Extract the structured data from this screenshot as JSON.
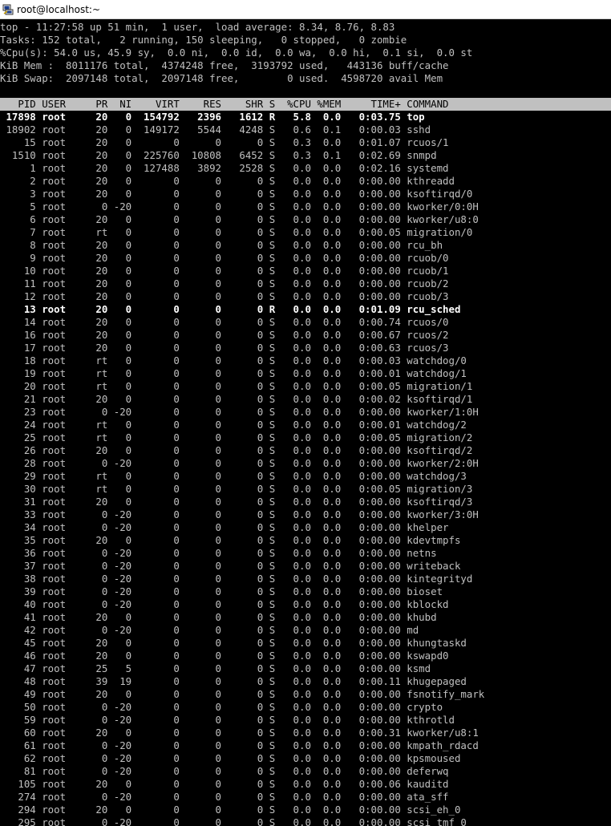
{
  "window": {
    "title": "root@localhost:~",
    "icon": "putty-icon"
  },
  "summary": [
    "top - 11:27:58 up 51 min,  1 user,  load average: 8.34, 8.76, 8.83",
    "Tasks: 152 total,   2 running, 150 sleeping,   0 stopped,   0 zombie",
    "%Cpu(s): 54.0 us, 45.9 sy,  0.0 ni,  0.0 id,  0.0 wa,  0.0 hi,  0.1 si,  0.0 st",
    "KiB Mem :  8011176 total,  4374248 free,  3193792 used,   443136 buff/cache",
    "KiB Swap:  2097148 total,  2097148 free,        0 used.  4598720 avail Mem"
  ],
  "columns": [
    "PID",
    "USER",
    "PR",
    "NI",
    "VIRT",
    "RES",
    "SHR",
    "S",
    "%CPU",
    "%MEM",
    "TIME+",
    "COMMAND"
  ],
  "processes": [
    [
      "17898",
      "root",
      "20",
      "0",
      "154792",
      "2396",
      "1612",
      "R",
      "5.8",
      "0.0",
      "0:03.75",
      "top"
    ],
    [
      "18902",
      "root",
      "20",
      "0",
      "149172",
      "5544",
      "4248",
      "S",
      "0.6",
      "0.1",
      "0:00.03",
      "sshd"
    ],
    [
      "15",
      "root",
      "20",
      "0",
      "0",
      "0",
      "0",
      "S",
      "0.3",
      "0.0",
      "0:01.07",
      "rcuos/1"
    ],
    [
      "1510",
      "root",
      "20",
      "0",
      "225760",
      "10808",
      "6452",
      "S",
      "0.3",
      "0.1",
      "0:02.69",
      "snmpd"
    ],
    [
      "1",
      "root",
      "20",
      "0",
      "127488",
      "3892",
      "2528",
      "S",
      "0.0",
      "0.0",
      "0:02.16",
      "systemd"
    ],
    [
      "2",
      "root",
      "20",
      "0",
      "0",
      "0",
      "0",
      "S",
      "0.0",
      "0.0",
      "0:00.00",
      "kthreadd"
    ],
    [
      "3",
      "root",
      "20",
      "0",
      "0",
      "0",
      "0",
      "S",
      "0.0",
      "0.0",
      "0:00.00",
      "ksoftirqd/0"
    ],
    [
      "5",
      "root",
      "0",
      "-20",
      "0",
      "0",
      "0",
      "S",
      "0.0",
      "0.0",
      "0:00.00",
      "kworker/0:0H"
    ],
    [
      "6",
      "root",
      "20",
      "0",
      "0",
      "0",
      "0",
      "S",
      "0.0",
      "0.0",
      "0:00.00",
      "kworker/u8:0"
    ],
    [
      "7",
      "root",
      "rt",
      "0",
      "0",
      "0",
      "0",
      "S",
      "0.0",
      "0.0",
      "0:00.05",
      "migration/0"
    ],
    [
      "8",
      "root",
      "20",
      "0",
      "0",
      "0",
      "0",
      "S",
      "0.0",
      "0.0",
      "0:00.00",
      "rcu_bh"
    ],
    [
      "9",
      "root",
      "20",
      "0",
      "0",
      "0",
      "0",
      "S",
      "0.0",
      "0.0",
      "0:00.00",
      "rcuob/0"
    ],
    [
      "10",
      "root",
      "20",
      "0",
      "0",
      "0",
      "0",
      "S",
      "0.0",
      "0.0",
      "0:00.00",
      "rcuob/1"
    ],
    [
      "11",
      "root",
      "20",
      "0",
      "0",
      "0",
      "0",
      "S",
      "0.0",
      "0.0",
      "0:00.00",
      "rcuob/2"
    ],
    [
      "12",
      "root",
      "20",
      "0",
      "0",
      "0",
      "0",
      "S",
      "0.0",
      "0.0",
      "0:00.00",
      "rcuob/3"
    ],
    [
      "13",
      "root",
      "20",
      "0",
      "0",
      "0",
      "0",
      "R",
      "0.0",
      "0.0",
      "0:01.09",
      "rcu_sched"
    ],
    [
      "14",
      "root",
      "20",
      "0",
      "0",
      "0",
      "0",
      "S",
      "0.0",
      "0.0",
      "0:00.74",
      "rcuos/0"
    ],
    [
      "16",
      "root",
      "20",
      "0",
      "0",
      "0",
      "0",
      "S",
      "0.0",
      "0.0",
      "0:00.67",
      "rcuos/2"
    ],
    [
      "17",
      "root",
      "20",
      "0",
      "0",
      "0",
      "0",
      "S",
      "0.0",
      "0.0",
      "0:00.63",
      "rcuos/3"
    ],
    [
      "18",
      "root",
      "rt",
      "0",
      "0",
      "0",
      "0",
      "S",
      "0.0",
      "0.0",
      "0:00.03",
      "watchdog/0"
    ],
    [
      "19",
      "root",
      "rt",
      "0",
      "0",
      "0",
      "0",
      "S",
      "0.0",
      "0.0",
      "0:00.01",
      "watchdog/1"
    ],
    [
      "20",
      "root",
      "rt",
      "0",
      "0",
      "0",
      "0",
      "S",
      "0.0",
      "0.0",
      "0:00.05",
      "migration/1"
    ],
    [
      "21",
      "root",
      "20",
      "0",
      "0",
      "0",
      "0",
      "S",
      "0.0",
      "0.0",
      "0:00.02",
      "ksoftirqd/1"
    ],
    [
      "23",
      "root",
      "0",
      "-20",
      "0",
      "0",
      "0",
      "S",
      "0.0",
      "0.0",
      "0:00.00",
      "kworker/1:0H"
    ],
    [
      "24",
      "root",
      "rt",
      "0",
      "0",
      "0",
      "0",
      "S",
      "0.0",
      "0.0",
      "0:00.01",
      "watchdog/2"
    ],
    [
      "25",
      "root",
      "rt",
      "0",
      "0",
      "0",
      "0",
      "S",
      "0.0",
      "0.0",
      "0:00.05",
      "migration/2"
    ],
    [
      "26",
      "root",
      "20",
      "0",
      "0",
      "0",
      "0",
      "S",
      "0.0",
      "0.0",
      "0:00.00",
      "ksoftirqd/2"
    ],
    [
      "28",
      "root",
      "0",
      "-20",
      "0",
      "0",
      "0",
      "S",
      "0.0",
      "0.0",
      "0:00.00",
      "kworker/2:0H"
    ],
    [
      "29",
      "root",
      "rt",
      "0",
      "0",
      "0",
      "0",
      "S",
      "0.0",
      "0.0",
      "0:00.00",
      "watchdog/3"
    ],
    [
      "30",
      "root",
      "rt",
      "0",
      "0",
      "0",
      "0",
      "S",
      "0.0",
      "0.0",
      "0:00.05",
      "migration/3"
    ],
    [
      "31",
      "root",
      "20",
      "0",
      "0",
      "0",
      "0",
      "S",
      "0.0",
      "0.0",
      "0:00.00",
      "ksoftirqd/3"
    ],
    [
      "33",
      "root",
      "0",
      "-20",
      "0",
      "0",
      "0",
      "S",
      "0.0",
      "0.0",
      "0:00.00",
      "kworker/3:0H"
    ],
    [
      "34",
      "root",
      "0",
      "-20",
      "0",
      "0",
      "0",
      "S",
      "0.0",
      "0.0",
      "0:00.00",
      "khelper"
    ],
    [
      "35",
      "root",
      "20",
      "0",
      "0",
      "0",
      "0",
      "S",
      "0.0",
      "0.0",
      "0:00.00",
      "kdevtmpfs"
    ],
    [
      "36",
      "root",
      "0",
      "-20",
      "0",
      "0",
      "0",
      "S",
      "0.0",
      "0.0",
      "0:00.00",
      "netns"
    ],
    [
      "37",
      "root",
      "0",
      "-20",
      "0",
      "0",
      "0",
      "S",
      "0.0",
      "0.0",
      "0:00.00",
      "writeback"
    ],
    [
      "38",
      "root",
      "0",
      "-20",
      "0",
      "0",
      "0",
      "S",
      "0.0",
      "0.0",
      "0:00.00",
      "kintegrityd"
    ],
    [
      "39",
      "root",
      "0",
      "-20",
      "0",
      "0",
      "0",
      "S",
      "0.0",
      "0.0",
      "0:00.00",
      "bioset"
    ],
    [
      "40",
      "root",
      "0",
      "-20",
      "0",
      "0",
      "0",
      "S",
      "0.0",
      "0.0",
      "0:00.00",
      "kblockd"
    ],
    [
      "41",
      "root",
      "20",
      "0",
      "0",
      "0",
      "0",
      "S",
      "0.0",
      "0.0",
      "0:00.00",
      "khubd"
    ],
    [
      "42",
      "root",
      "0",
      "-20",
      "0",
      "0",
      "0",
      "S",
      "0.0",
      "0.0",
      "0:00.00",
      "md"
    ],
    [
      "45",
      "root",
      "20",
      "0",
      "0",
      "0",
      "0",
      "S",
      "0.0",
      "0.0",
      "0:00.00",
      "khungtaskd"
    ],
    [
      "46",
      "root",
      "20",
      "0",
      "0",
      "0",
      "0",
      "S",
      "0.0",
      "0.0",
      "0:00.00",
      "kswapd0"
    ],
    [
      "47",
      "root",
      "25",
      "5",
      "0",
      "0",
      "0",
      "S",
      "0.0",
      "0.0",
      "0:00.00",
      "ksmd"
    ],
    [
      "48",
      "root",
      "39",
      "19",
      "0",
      "0",
      "0",
      "S",
      "0.0",
      "0.0",
      "0:00.11",
      "khugepaged"
    ],
    [
      "49",
      "root",
      "20",
      "0",
      "0",
      "0",
      "0",
      "S",
      "0.0",
      "0.0",
      "0:00.00",
      "fsnotify_mark"
    ],
    [
      "50",
      "root",
      "0",
      "-20",
      "0",
      "0",
      "0",
      "S",
      "0.0",
      "0.0",
      "0:00.00",
      "crypto"
    ],
    [
      "59",
      "root",
      "0",
      "-20",
      "0",
      "0",
      "0",
      "S",
      "0.0",
      "0.0",
      "0:00.00",
      "kthrotld"
    ],
    [
      "60",
      "root",
      "20",
      "0",
      "0",
      "0",
      "0",
      "S",
      "0.0",
      "0.0",
      "0:00.31",
      "kworker/u8:1"
    ],
    [
      "61",
      "root",
      "0",
      "-20",
      "0",
      "0",
      "0",
      "S",
      "0.0",
      "0.0",
      "0:00.00",
      "kmpath_rdacd"
    ],
    [
      "62",
      "root",
      "0",
      "-20",
      "0",
      "0",
      "0",
      "S",
      "0.0",
      "0.0",
      "0:00.00",
      "kpsmoused"
    ],
    [
      "81",
      "root",
      "0",
      "-20",
      "0",
      "0",
      "0",
      "S",
      "0.0",
      "0.0",
      "0:00.00",
      "deferwq"
    ],
    [
      "105",
      "root",
      "20",
      "0",
      "0",
      "0",
      "0",
      "S",
      "0.0",
      "0.0",
      "0:00.06",
      "kauditd"
    ],
    [
      "274",
      "root",
      "0",
      "-20",
      "0",
      "0",
      "0",
      "S",
      "0.0",
      "0.0",
      "0:00.00",
      "ata_sff"
    ],
    [
      "294",
      "root",
      "20",
      "0",
      "0",
      "0",
      "0",
      "S",
      "0.0",
      "0.0",
      "0:00.00",
      "scsi_eh_0"
    ],
    [
      "295",
      "root",
      "0",
      "-20",
      "0",
      "0",
      "0",
      "S",
      "0.0",
      "0.0",
      "0:00.00",
      "scsi_tmf_0"
    ]
  ],
  "colors": {
    "background": "#000000",
    "text": "#c0c0c0",
    "bold_text": "#ffffff",
    "header_bg": "#c0c0c0",
    "titlebar_bg": "#ffffff"
  }
}
